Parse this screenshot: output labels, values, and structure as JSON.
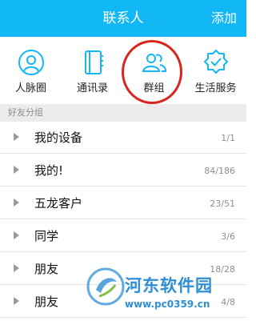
{
  "header": {
    "title": "联系人",
    "action_label": "添加",
    "background": "#12b7f5"
  },
  "quick_actions": [
    {
      "label": "人脉圈",
      "icon": "contacts-circle-icon"
    },
    {
      "label": "通讯录",
      "icon": "address-book-icon"
    },
    {
      "label": "群组",
      "icon": "group-icon"
    },
    {
      "label": "生活服务",
      "icon": "service-badge-icon"
    }
  ],
  "highlight_color": "#d9251c",
  "section": {
    "title": "好友分组"
  },
  "groups": [
    {
      "name": "我的设备",
      "count": "1/1"
    },
    {
      "name": "我的!",
      "count": "84/186"
    },
    {
      "name": "五龙客户",
      "count": "23/51"
    },
    {
      "name": "同学",
      "count": "3/6"
    },
    {
      "name": "朋友",
      "count": "18/28"
    },
    {
      "name": "朋友",
      "count": "4/8"
    }
  ],
  "watermark": {
    "title": "河东软件园",
    "url": "www.pc0359.cn"
  }
}
